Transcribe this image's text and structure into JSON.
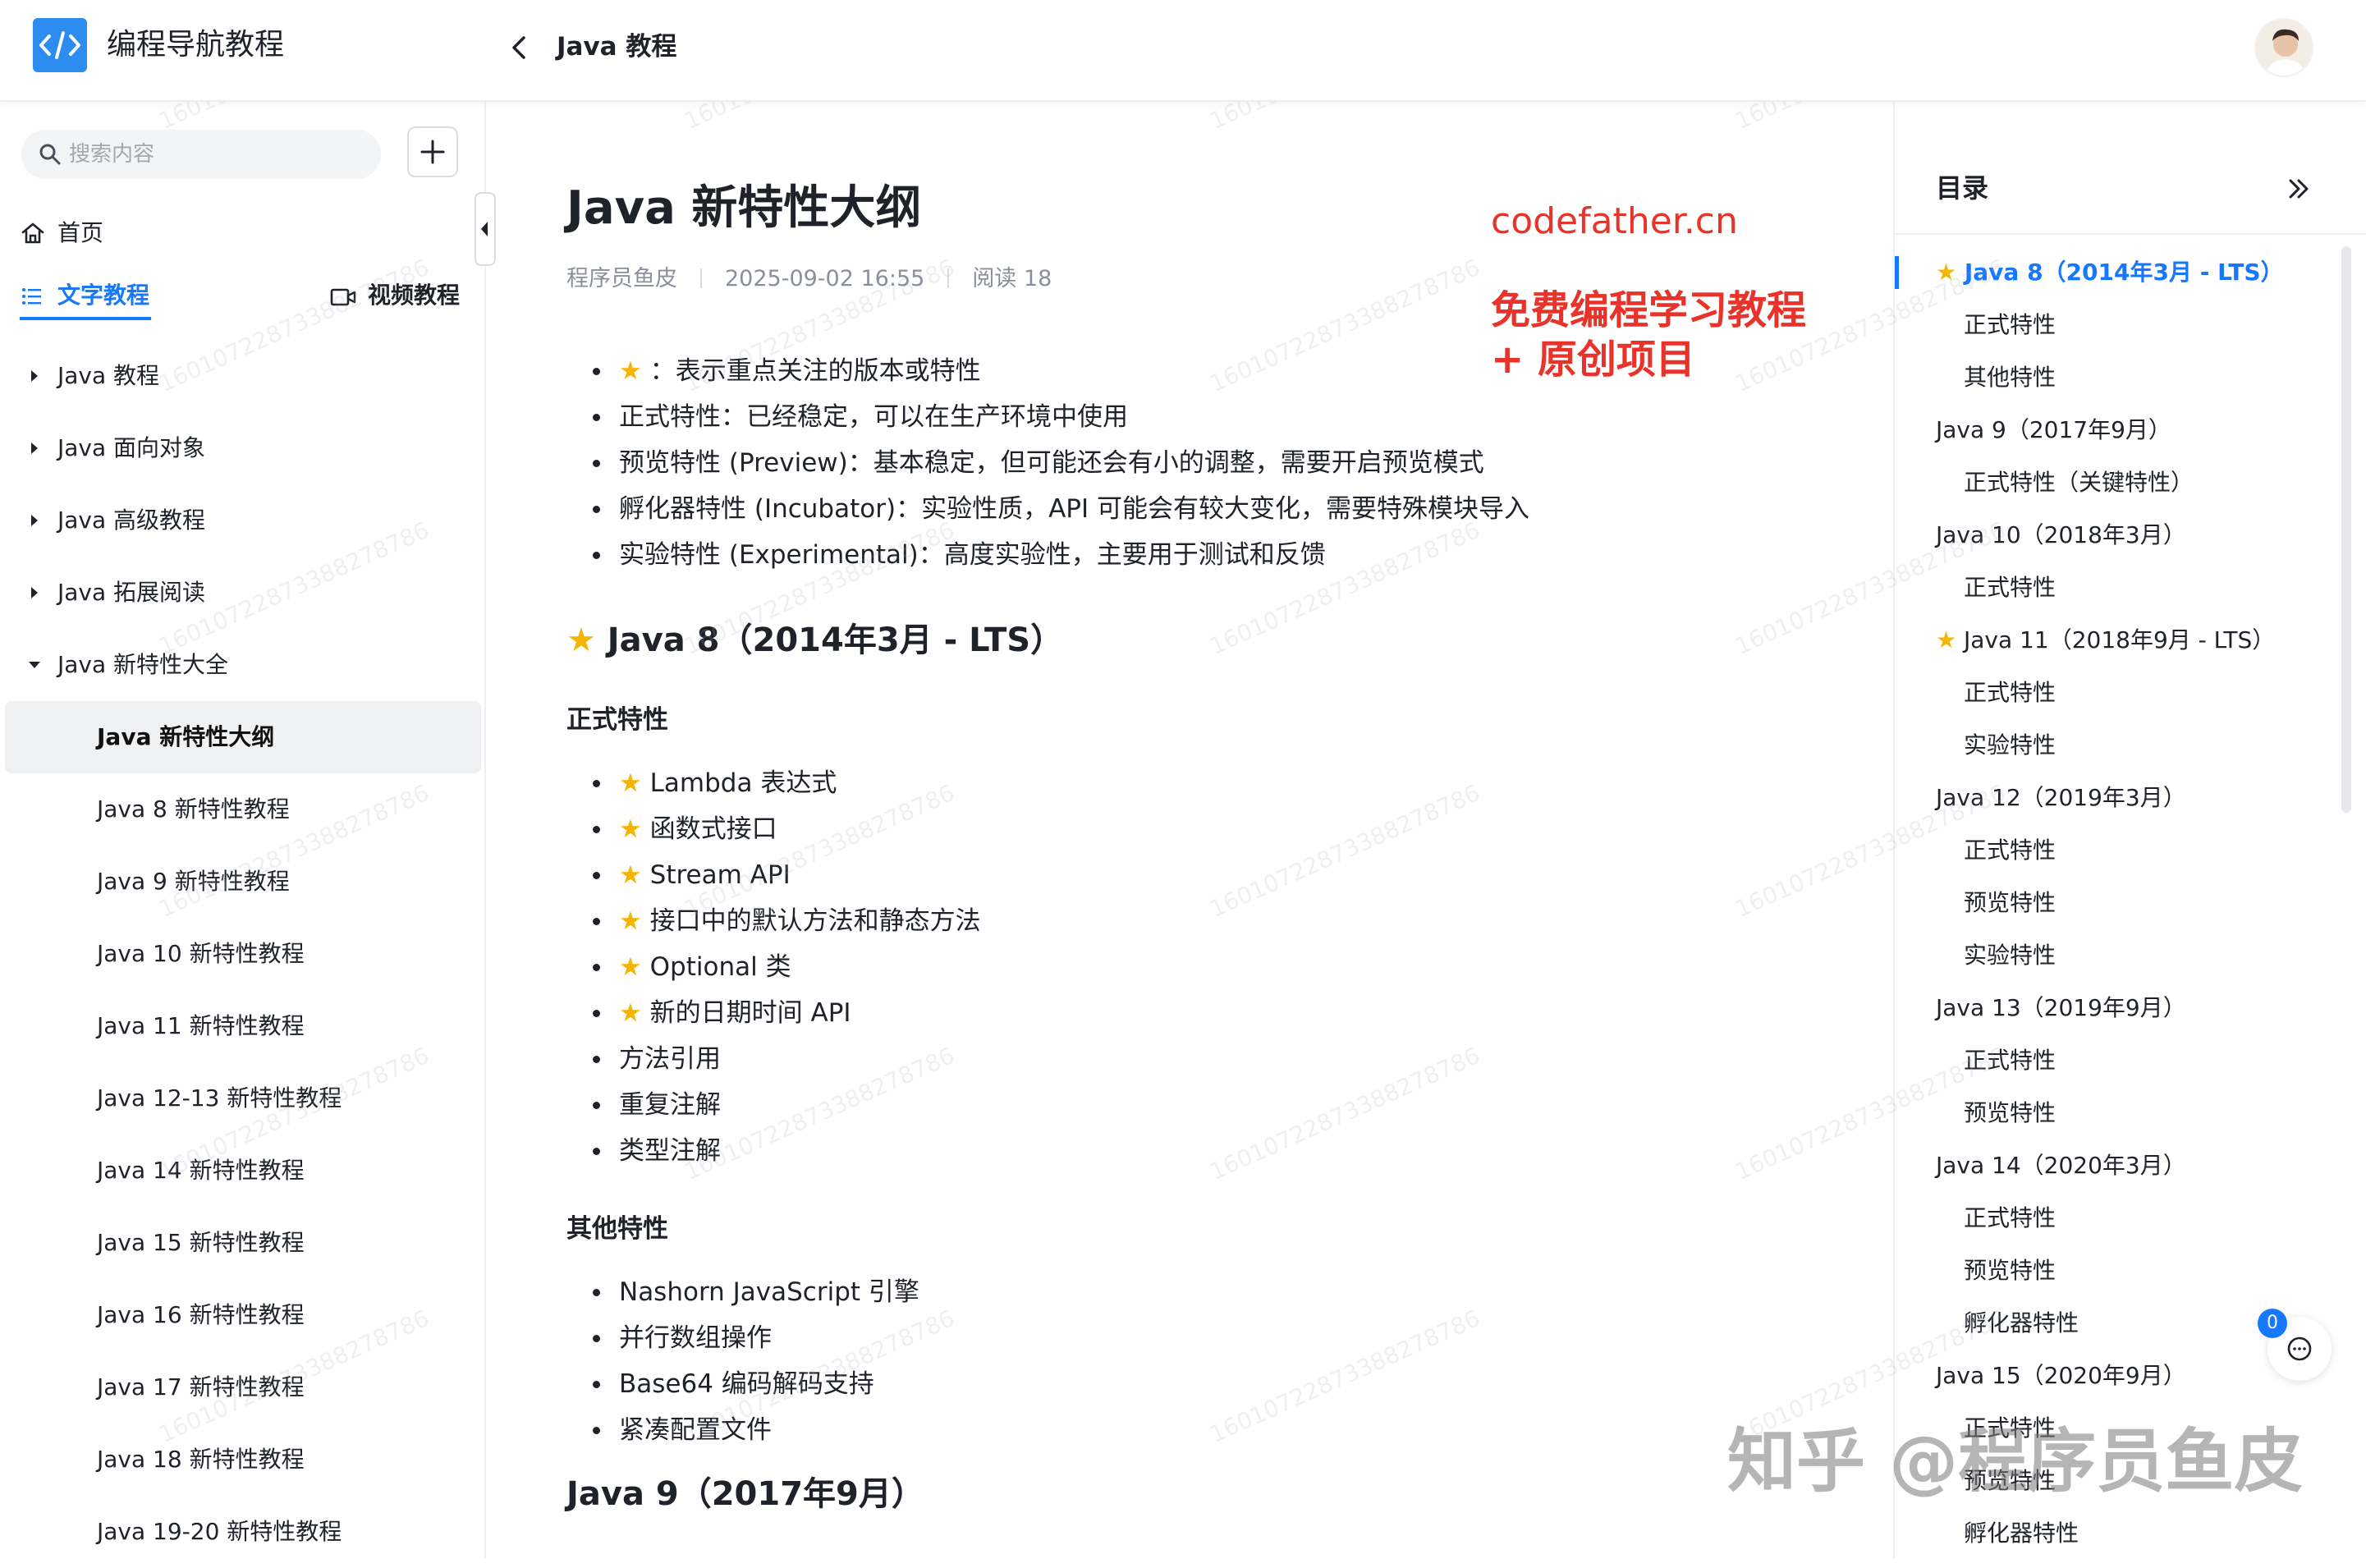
{
  "colors": {
    "accent": "#1677ff",
    "promo_red": "#e8332a",
    "star": "#f5b400"
  },
  "header": {
    "app_title": "编程导航教程",
    "breadcrumb": "Java 教程",
    "logo_icon": "code-brackets-icon",
    "back_icon": "chevron-left-icon"
  },
  "sidebar": {
    "search_placeholder": "搜索内容",
    "home_label": "首页",
    "tab_text_label": "文字教程",
    "tab_video_label": "视频教程",
    "tree": [
      {
        "label": "Java 教程",
        "level": 1,
        "expanded": false
      },
      {
        "label": "Java 面向对象",
        "level": 1,
        "expanded": false
      },
      {
        "label": "Java 高级教程",
        "level": 1,
        "expanded": false
      },
      {
        "label": "Java 拓展阅读",
        "level": 1,
        "expanded": false
      },
      {
        "label": "Java 新特性大全",
        "level": 1,
        "expanded": true
      },
      {
        "label": "Java 新特性大纲",
        "level": 2,
        "active": true
      },
      {
        "label": "Java 8 新特性教程",
        "level": 2
      },
      {
        "label": "Java 9 新特性教程",
        "level": 2
      },
      {
        "label": "Java 10 新特性教程",
        "level": 2
      },
      {
        "label": "Java 11 新特性教程",
        "level": 2
      },
      {
        "label": "Java 12-13 新特性教程",
        "level": 2
      },
      {
        "label": "Java 14 新特性教程",
        "level": 2
      },
      {
        "label": "Java 15 新特性教程",
        "level": 2
      },
      {
        "label": "Java 16 新特性教程",
        "level": 2
      },
      {
        "label": "Java 17 新特性教程",
        "level": 2
      },
      {
        "label": "Java 18 新特性教程",
        "level": 2
      },
      {
        "label": "Java 19-20 新特性教程",
        "level": 2
      }
    ]
  },
  "article": {
    "title": "Java 新特性大纲",
    "author": "程序员鱼皮",
    "date": "2025-09-02 16:55",
    "reads": "阅读 18",
    "promo_line1": "codefather.cn",
    "promo_line2a": "免费编程学习教程",
    "promo_line2b": "+ 原创项目",
    "legend": [
      {
        "star": true,
        "text": "：表示重点关注的版本或特性"
      },
      {
        "star": false,
        "text": "正式特性：已经稳定，可以在生产环境中使用"
      },
      {
        "star": false,
        "text": "预览特性 (Preview)：基本稳定，但可能还会有小的调整，需要开启预览模式"
      },
      {
        "star": false,
        "text": "孵化器特性 (Incubator)：实验性质，API 可能会有较大变化，需要特殊模块导入"
      },
      {
        "star": false,
        "text": "实验特性 (Experimental)：高度实验性，主要用于测试和反馈"
      }
    ],
    "section_java8": "Java 8（2014年3月 - LTS）",
    "sub_formal": "正式特性",
    "java8_formal": [
      {
        "star": true,
        "text": "Lambda 表达式"
      },
      {
        "star": true,
        "text": "函数式接口"
      },
      {
        "star": true,
        "text": "Stream API"
      },
      {
        "star": true,
        "text": "接口中的默认方法和静态方法"
      },
      {
        "star": true,
        "text": "Optional 类"
      },
      {
        "star": true,
        "text": "新的日期时间 API"
      },
      {
        "star": false,
        "text": "方法引用"
      },
      {
        "star": false,
        "text": "重复注解"
      },
      {
        "star": false,
        "text": "类型注解"
      }
    ],
    "sub_other": "其他特性",
    "java8_other": [
      {
        "star": false,
        "text": "Nashorn JavaScript 引擎"
      },
      {
        "star": false,
        "text": "并行数组操作"
      },
      {
        "star": false,
        "text": "Base64 编码解码支持"
      },
      {
        "star": false,
        "text": "紧凑配置文件"
      }
    ],
    "section_java9": "Java 9（2017年9月）",
    "watermark_text": "16010722873388278786"
  },
  "toc": {
    "title": "目录",
    "items": [
      {
        "label": "Java 8（2014年3月 - LTS）",
        "level": 1,
        "star": true,
        "active": true
      },
      {
        "label": "正式特性",
        "level": 2
      },
      {
        "label": "其他特性",
        "level": 2
      },
      {
        "label": "Java 9（2017年9月）",
        "level": 1
      },
      {
        "label": "正式特性（关键特性）",
        "level": 2
      },
      {
        "label": "Java 10（2018年3月）",
        "level": 1
      },
      {
        "label": "正式特性",
        "level": 2
      },
      {
        "label": "Java 11（2018年9月 - LTS）",
        "level": 1,
        "star": true
      },
      {
        "label": "正式特性",
        "level": 2
      },
      {
        "label": "实验特性",
        "level": 2
      },
      {
        "label": "Java 12（2019年3月）",
        "level": 1
      },
      {
        "label": "正式特性",
        "level": 2
      },
      {
        "label": "预览特性",
        "level": 2
      },
      {
        "label": "实验特性",
        "level": 2
      },
      {
        "label": "Java 13（2019年9月）",
        "level": 1
      },
      {
        "label": "正式特性",
        "level": 2
      },
      {
        "label": "预览特性",
        "level": 2
      },
      {
        "label": "Java 14（2020年3月）",
        "level": 1
      },
      {
        "label": "正式特性",
        "level": 2
      },
      {
        "label": "预览特性",
        "level": 2
      },
      {
        "label": "孵化器特性",
        "level": 2
      },
      {
        "label": "Java 15（2020年9月）",
        "level": 1
      },
      {
        "label": "正式特性",
        "level": 2
      },
      {
        "label": "预览特性",
        "level": 2
      },
      {
        "label": "孵化器特性",
        "level": 2
      }
    ]
  },
  "chat": {
    "badge_count": "0"
  },
  "overlay": {
    "zhihu_watermark": "知乎 @程序员鱼皮"
  }
}
